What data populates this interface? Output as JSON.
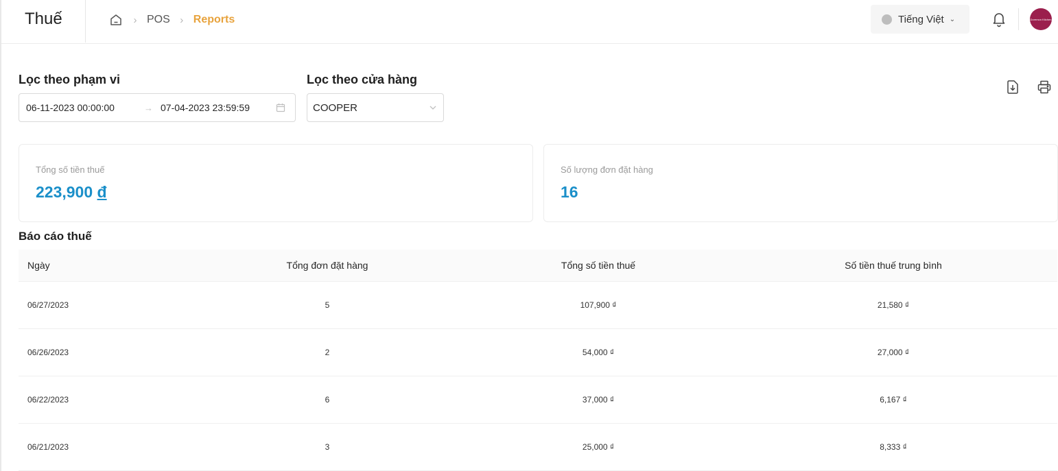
{
  "header": {
    "title": "Thuế",
    "breadcrumb": {
      "item1": "POS",
      "current": "Reports"
    },
    "language": "Tiếng Việt",
    "avatar_text": "Doremon Kitchen"
  },
  "filters": {
    "range_label": "Lọc theo phạm vi",
    "date_start": "06-11-2023 00:00:00",
    "date_arrow": "→",
    "date_end": "07-04-2023 23:59:59",
    "store_label": "Lọc theo cửa hàng",
    "store_value": "COOPER"
  },
  "stats": {
    "total_tax_label": "Tổng số tiền thuế",
    "total_tax_value": "223,900",
    "currency": "đ",
    "orders_label": "Số lượng đơn đặt hàng",
    "orders_value": "16"
  },
  "report": {
    "title": "Báo cáo thuế",
    "columns": [
      "Ngày",
      "Tổng đơn đặt hàng",
      "Tổng số tiền thuế",
      "Số tiền thuế trung bình"
    ],
    "rows": [
      {
        "date": "06/27/2023",
        "orders": "5",
        "total_tax": "107,900 ₫",
        "avg_tax": "21,580 ₫"
      },
      {
        "date": "06/26/2023",
        "orders": "2",
        "total_tax": "54,000 ₫",
        "avg_tax": "27,000 ₫"
      },
      {
        "date": "06/22/2023",
        "orders": "6",
        "total_tax": "37,000 ₫",
        "avg_tax": "6,167 ₫"
      },
      {
        "date": "06/21/2023",
        "orders": "3",
        "total_tax": "25,000 ₫",
        "avg_tax": "8,333 ₫"
      }
    ]
  },
  "icons": {
    "home": "home-icon",
    "bell": "bell-icon",
    "calendar": "calendar-icon",
    "download": "download-icon",
    "print": "printer-icon"
  },
  "colors": {
    "accent_blue": "#1a8fc9",
    "breadcrumb_active": "#e8a33d",
    "avatar_bg": "#9b1f4d"
  }
}
